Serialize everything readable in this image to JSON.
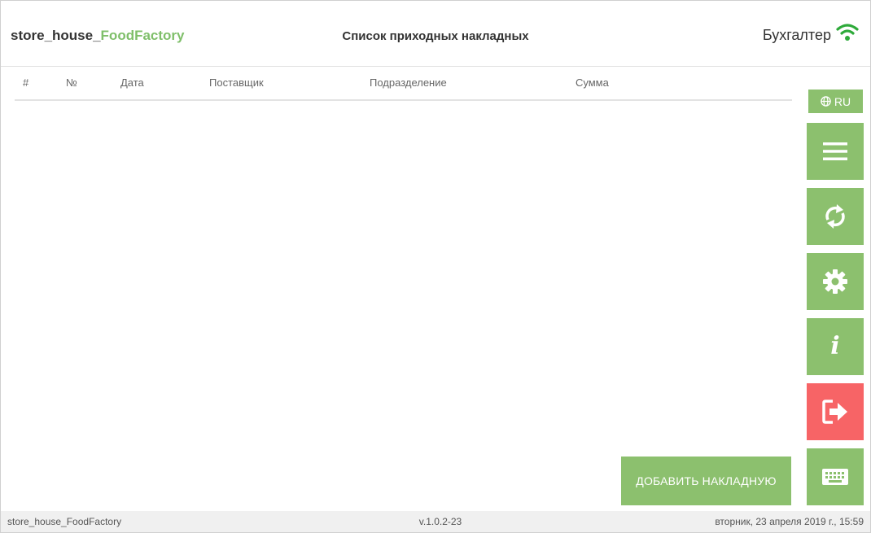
{
  "header": {
    "brand_prefix": "store_house_",
    "brand_accent": "FoodFactory",
    "title": "Список приходных накладных",
    "user": "Бухгалтер",
    "status_icon": "wifi-icon"
  },
  "table": {
    "columns": [
      "#",
      "№",
      "Дата",
      "Поставщик",
      "Подразделение",
      "Сумма"
    ],
    "rows": []
  },
  "sidebar": {
    "language": "RU",
    "buttons": [
      {
        "icon": "menu-icon"
      },
      {
        "icon": "refresh-icon"
      },
      {
        "icon": "settings-icon"
      },
      {
        "icon": "info-icon",
        "glyph": "i"
      },
      {
        "icon": "logout-icon"
      },
      {
        "icon": "keyboard-icon"
      }
    ]
  },
  "actions": {
    "add_invoice": "ДОБАВИТЬ НАКЛАДНУЮ"
  },
  "footer": {
    "app_name": "store_house_FoodFactory",
    "version": "v.1.0.2-23",
    "datetime": "вторник, 23 апреля 2019 г., 15:59"
  },
  "colors": {
    "accent": "#8cc06e",
    "danger": "#f76466",
    "brand_accent": "#7fbf6a"
  }
}
